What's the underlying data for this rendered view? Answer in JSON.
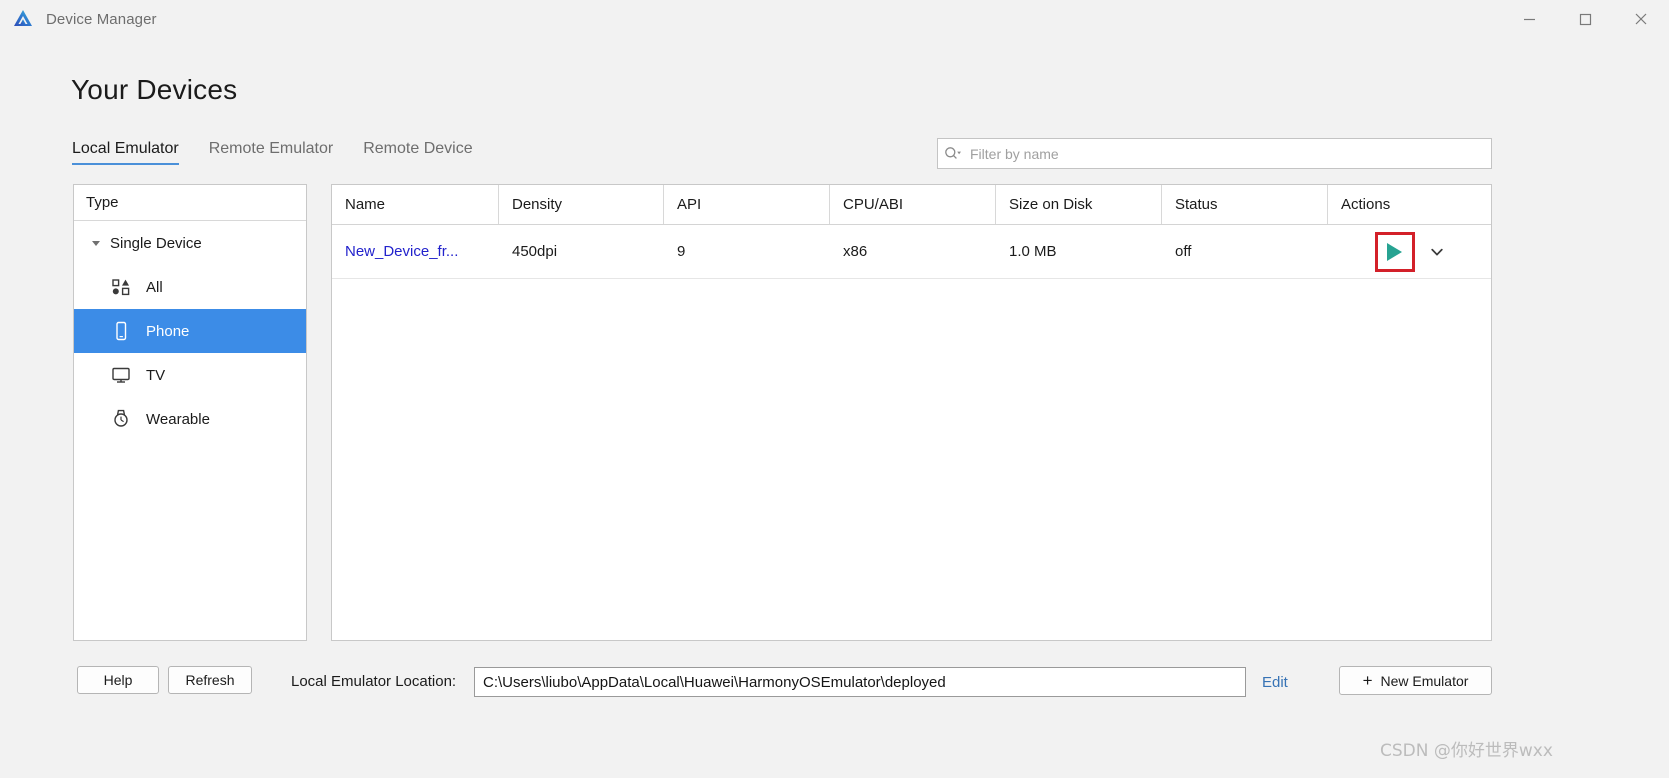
{
  "window": {
    "title": "Device Manager",
    "logo_icon": "deveco-studio-logo-icon",
    "controls": {
      "minimize": "minimize-icon",
      "maximize": "maximize-icon",
      "close": "close-icon"
    }
  },
  "page": {
    "title": "Your Devices"
  },
  "tabs": [
    {
      "label": "Local Emulator",
      "active": true
    },
    {
      "label": "Remote Emulator",
      "active": false
    },
    {
      "label": "Remote Device",
      "active": false
    }
  ],
  "search": {
    "icon": "search-icon",
    "placeholder": "Filter by name",
    "value": ""
  },
  "sidebar": {
    "header": "Type",
    "group": {
      "label": "Single Device",
      "expanded": true,
      "caret_icon": "caret-down-icon"
    },
    "items": [
      {
        "label": "All",
        "icon": "grid-shapes-icon",
        "selected": false
      },
      {
        "label": "Phone",
        "icon": "phone-icon",
        "selected": true
      },
      {
        "label": "TV",
        "icon": "tv-icon",
        "selected": false
      },
      {
        "label": "Wearable",
        "icon": "watch-icon",
        "selected": false
      }
    ]
  },
  "table": {
    "columns": [
      "Name",
      "Density",
      "API",
      "CPU/ABI",
      "Size on Disk",
      "Status",
      "Actions"
    ],
    "rows": [
      {
        "name": "New_Device_fr...",
        "density": "450dpi",
        "api": "9",
        "cpu_abi": "x86",
        "size_on_disk": "1.0 MB",
        "status": "off",
        "actions": {
          "play_icon": "play-icon",
          "menu_icon": "chevron-down-icon",
          "play_highlighted": true
        }
      }
    ]
  },
  "bottom": {
    "help_label": "Help",
    "refresh_label": "Refresh",
    "location_label": "Local Emulator Location:",
    "location_value": "C:\\Users\\liubo\\AppData\\Local\\Huawei\\HarmonyOSEmulator\\deployed",
    "edit_label": "Edit",
    "new_emulator_label": "New Emulator",
    "new_emulator_icon": "plus-icon"
  },
  "watermark": "CSDN @你好世界wxx",
  "colors": {
    "selection_blue": "#3c8ce7",
    "link_blue": "#2222cc",
    "edit_link_blue": "#3773b5",
    "play_teal": "#27a392",
    "highlight_red": "#d32029",
    "tab_underline": "#4a90d9",
    "window_bg": "#f2f2f2"
  }
}
